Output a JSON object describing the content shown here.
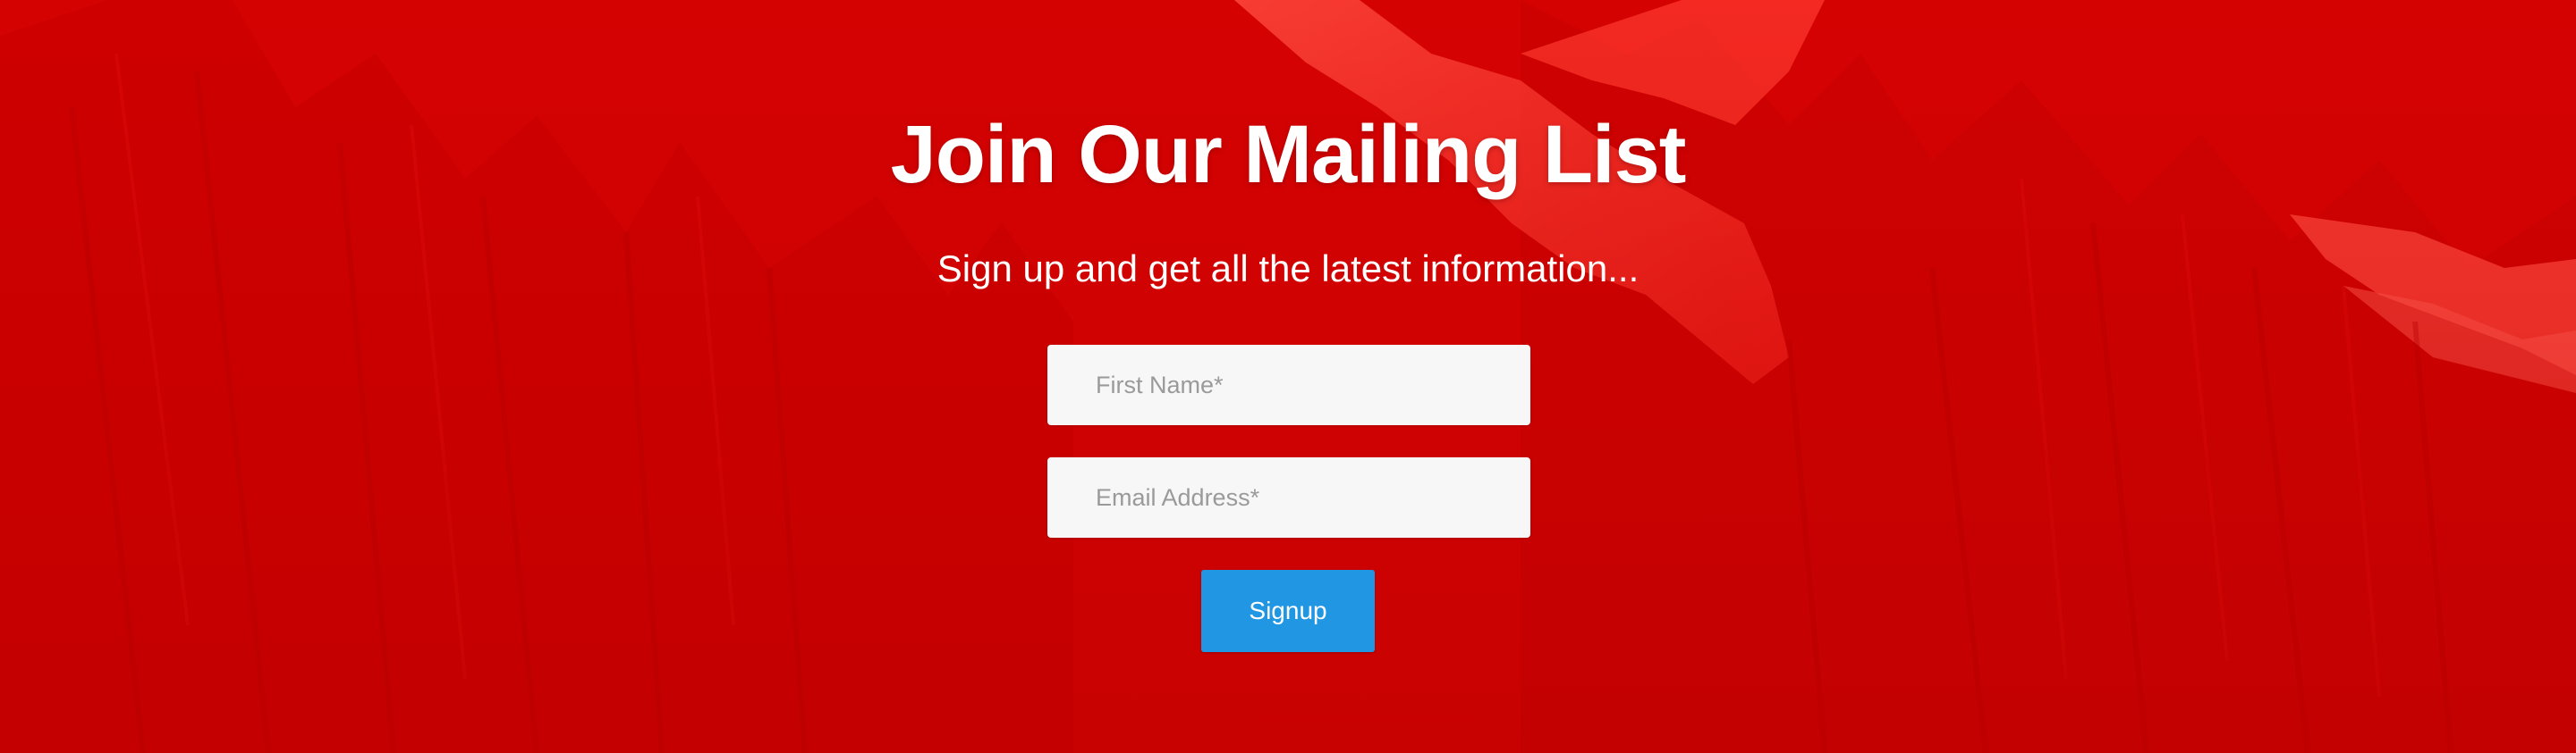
{
  "colors": {
    "background_red": "#d40000",
    "button_blue": "#2196e3",
    "field_background": "#f7f7f7",
    "placeholder_gray": "#9a9a9a",
    "text_white": "#ffffff"
  },
  "background": {
    "description_icon": "mountain-photo-background"
  },
  "mailing_list": {
    "title": "Join Our Mailing List",
    "subtitle": "Sign up and get all the latest information...",
    "first_name": {
      "placeholder": "First Name*",
      "value": ""
    },
    "email": {
      "placeholder": "Email Address*",
      "value": ""
    },
    "signup_label": "Signup"
  }
}
